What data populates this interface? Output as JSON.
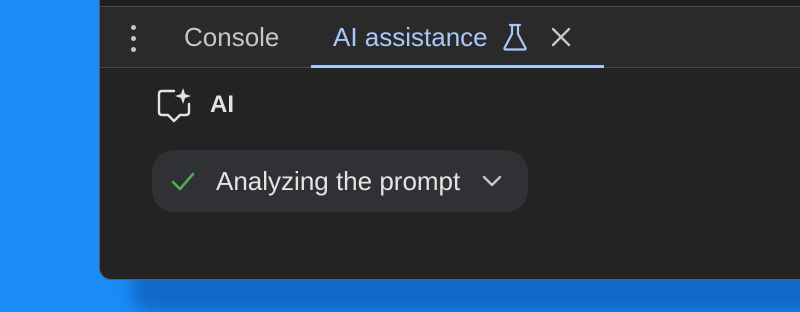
{
  "tabs": {
    "console_label": "Console",
    "ai_label": "AI assistance"
  },
  "icons": {
    "more": "kebab-menu-icon",
    "experiment": "flask-icon",
    "close": "close-icon",
    "ai": "spark-chat-icon",
    "step_status": "check-icon",
    "expand": "chevron-down-icon"
  },
  "ai_panel": {
    "name": "AI",
    "step": {
      "label": "Analyzing the prompt",
      "status": "done",
      "expanded": false
    }
  },
  "colors": {
    "accent": "#a8c7fa",
    "success": "#4caf50",
    "panel_bg": "#232323",
    "chip_bg": "#303134",
    "desktop_bg": "#1a8cf7"
  }
}
